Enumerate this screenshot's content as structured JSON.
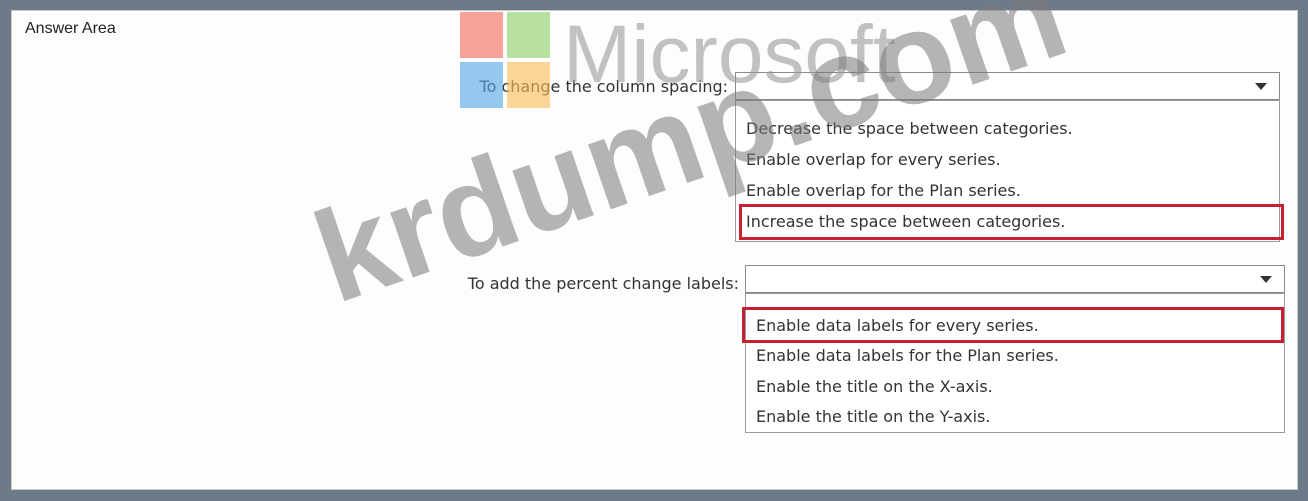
{
  "answer_area": {
    "title": "Answer Area"
  },
  "watermark": {
    "logo_text": "Microsoft",
    "site_text": "krdump.com"
  },
  "questions": [
    {
      "prompt": "To change the column spacing:",
      "selected": "",
      "options": [
        "Decrease the space between categories.",
        "Enable overlap for every series.",
        "Enable overlap for the Plan series.",
        "Increase the space between categories."
      ],
      "highlighted_option": "Increase the space between categories."
    },
    {
      "prompt": "To add the percent change labels:",
      "selected": "",
      "options": [
        "Enable data labels for every series.",
        "Enable data labels for the Plan series.",
        "Enable the title on the X-axis.",
        "Enable the title on the Y-axis."
      ],
      "highlighted_option": "Enable data labels for every series."
    }
  ],
  "colors": {
    "highlight": "#c42030",
    "frame": "#6d7a88"
  }
}
